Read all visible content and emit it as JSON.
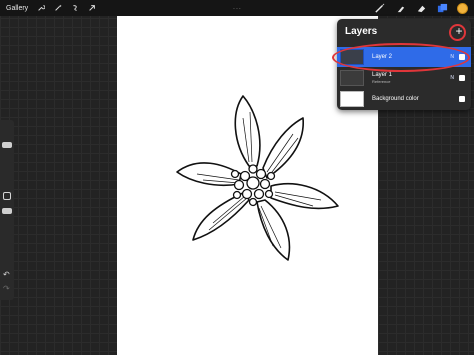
{
  "toolbar": {
    "gallery_label": "Gallery",
    "left_icons": [
      "wrench-icon",
      "magic-wand-icon",
      "selection-icon",
      "transform-arrow-icon"
    ],
    "right_icons": [
      "brush-icon",
      "smudge-icon",
      "eraser-icon",
      "layers-icon"
    ],
    "color_swatch": "#f2b33d",
    "more_dots": "..."
  },
  "sidebar": {
    "undo_glyph": "↶",
    "redo_glyph": "↷"
  },
  "layers_panel": {
    "title": "Layers",
    "add_glyph": "+",
    "items": [
      {
        "name": "Layer 2",
        "sub": "",
        "blend": "N",
        "visible": true,
        "selected": true
      },
      {
        "name": "Layer 1",
        "sub": "Reference",
        "blend": "N",
        "visible": true,
        "selected": false
      },
      {
        "name": "Background color",
        "sub": "",
        "blend": "",
        "visible": true,
        "selected": false
      }
    ]
  },
  "colors": {
    "accent": "#2f6be8",
    "highlight": "#e0363a"
  }
}
